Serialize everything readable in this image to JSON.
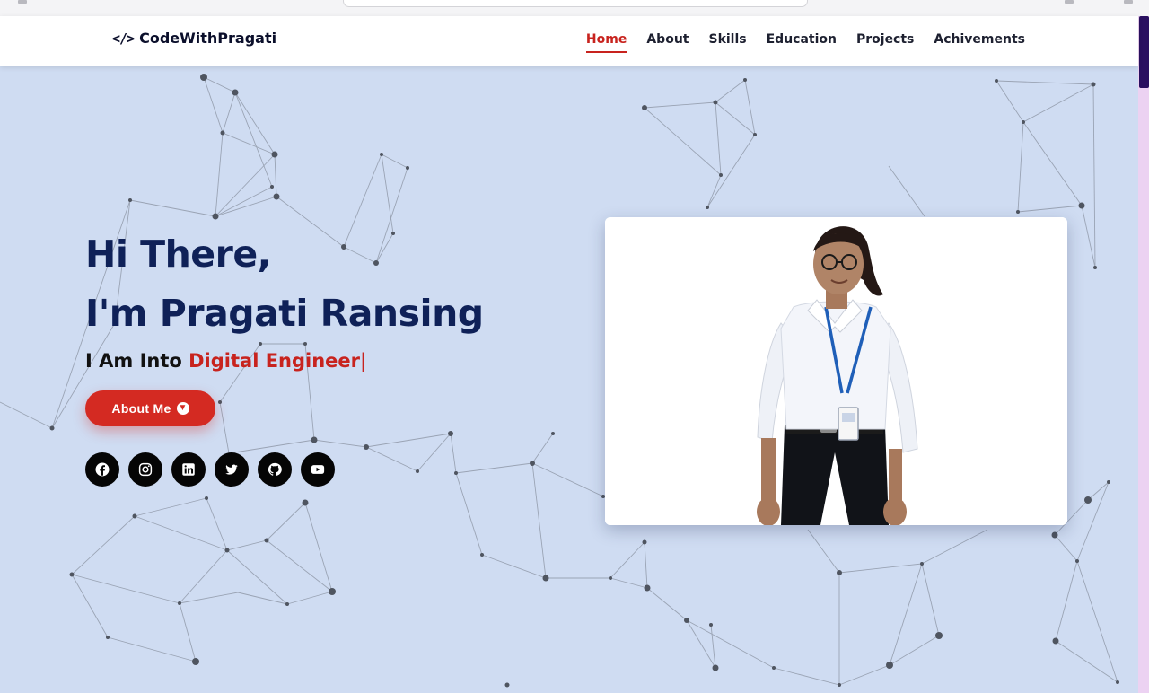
{
  "brand": {
    "name": "CodeWithPragati",
    "icon": "code-brackets-icon"
  },
  "nav": {
    "items": [
      {
        "label": "Home",
        "active": true
      },
      {
        "label": "About",
        "active": false
      },
      {
        "label": "Skills",
        "active": false
      },
      {
        "label": "Education",
        "active": false
      },
      {
        "label": "Projects",
        "active": false
      },
      {
        "label": "Achivements",
        "active": false
      }
    ]
  },
  "hero": {
    "greeting": "Hi There,",
    "name_line": "I'm Pragati Ransing",
    "tagline_prefix": "I Am Into",
    "tagline_highlight": "Digital Engineer",
    "cursor": "|",
    "button_label": "About Me"
  },
  "socials": [
    "facebook-icon",
    "instagram-icon",
    "linkedin-icon",
    "twitter-icon",
    "github-icon",
    "youtube-icon"
  ],
  "colors": {
    "accent": "#c8231e",
    "background": "#cfdcf2",
    "heading": "#0f2158",
    "social_bg": "#050505"
  }
}
